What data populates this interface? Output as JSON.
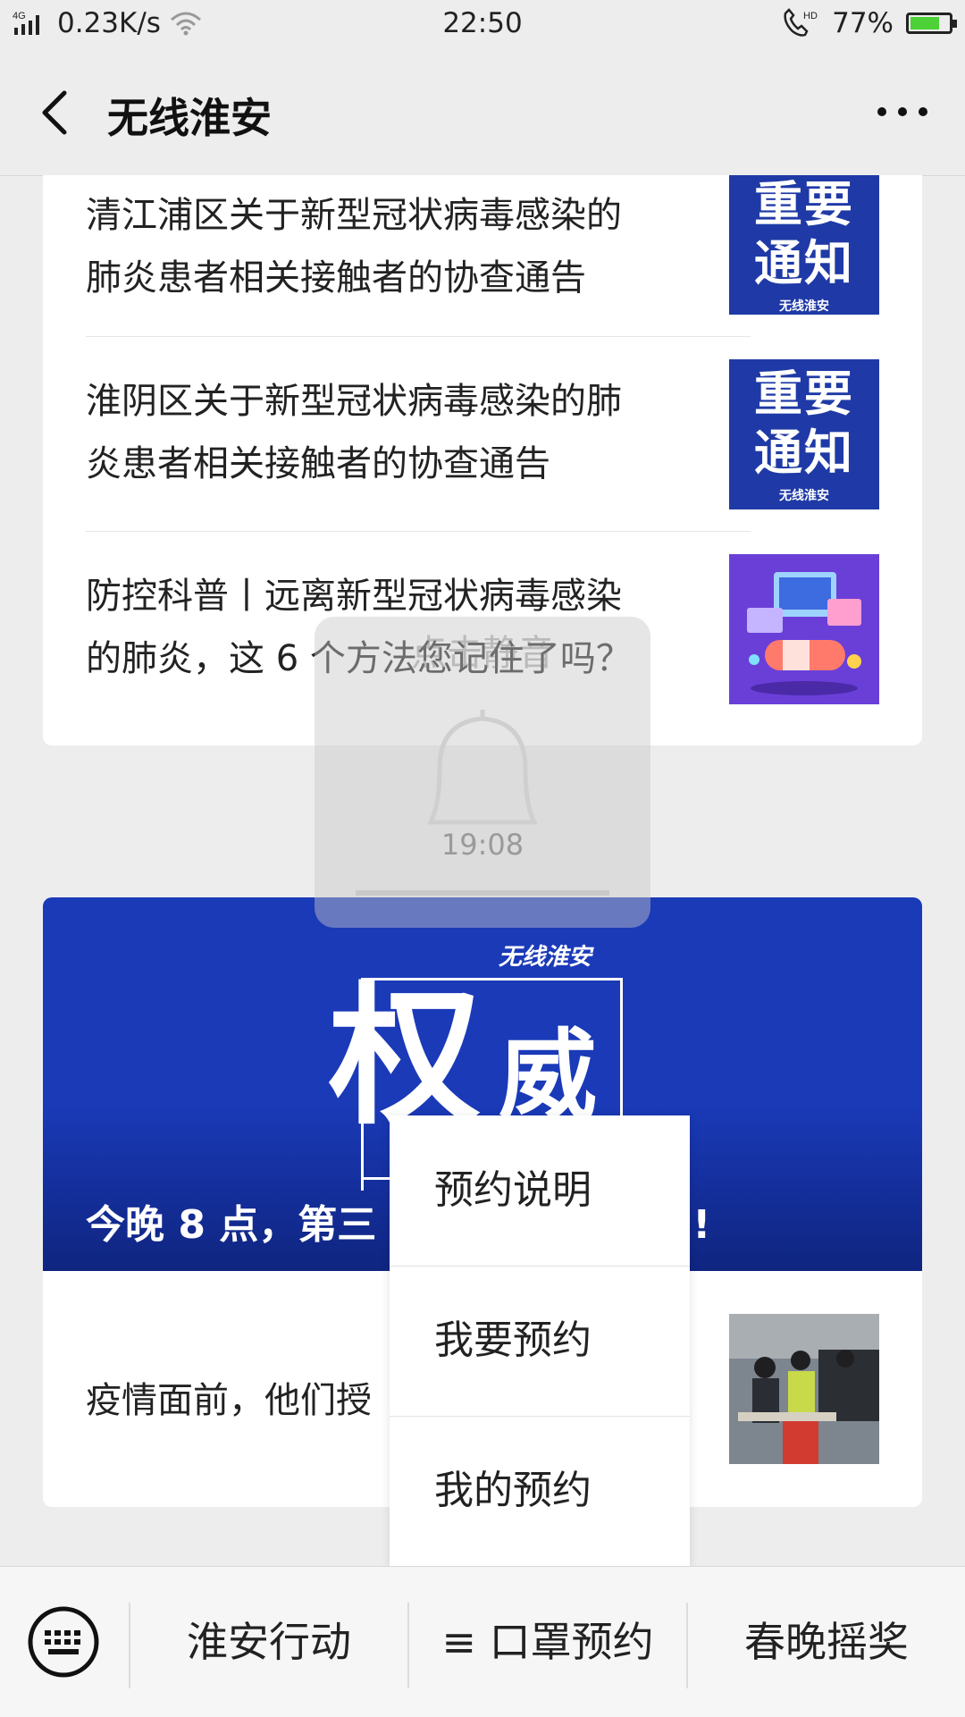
{
  "status_bar": {
    "signal": "4G",
    "speed": "0.23K/s",
    "time": "22:50",
    "hd": "HD",
    "battery": "77%",
    "battery_level": 0.77
  },
  "nav": {
    "title": "无线淮安"
  },
  "articles": [
    {
      "line1": "清江浦区关于新型冠状病毒感染的",
      "line2": "肺炎患者相关接触者的协查通告",
      "thumb_big1": "重要",
      "thumb_big2": "通知",
      "thumb_small": "无线淮安"
    },
    {
      "line1": "淮阴区关于新型冠状病毒感染的肺",
      "line2": "炎患者相关接触者的协查通告",
      "thumb_big1": "重要",
      "thumb_big2": "通知",
      "thumb_small": "无线淮安"
    },
    {
      "line1": "防控科普丨远离新型冠状病毒感染",
      "line2": "的肺炎，这 6 个方法您记住了吗？"
    }
  ],
  "toast": {
    "text": "点击静音",
    "time": "19:08"
  },
  "banner": {
    "logo": "无线淮安",
    "char1": "权",
    "char2": "威",
    "caption": "今晚 8 点，第三",
    "caption_tail": "启!"
  },
  "card2": {
    "text": "疫情面前，他们授"
  },
  "popup": {
    "items": [
      "预约说明",
      "我要预约",
      "我的预约"
    ]
  },
  "tabbar": {
    "tab1": "淮安行动",
    "tab2": "≡ 口罩预约",
    "tab3": "春晚摇奖"
  }
}
